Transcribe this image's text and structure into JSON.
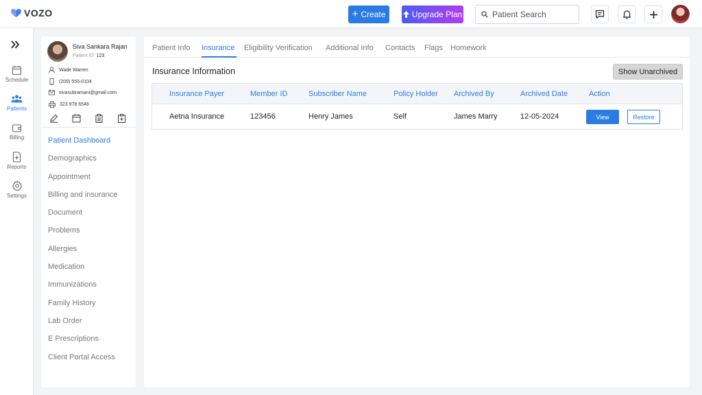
{
  "app": {
    "logo_text": "VOZO",
    "accent": "#2b7be4"
  },
  "header": {
    "create_label": "Create",
    "upgrade_label": "Upgrade Plan",
    "search": {
      "placeholder": "Patient Search",
      "value": ""
    },
    "icons": [
      "chat-icon",
      "bell-icon",
      "plus-icon"
    ]
  },
  "leftnav": {
    "items": [
      {
        "label": "Schedule",
        "icon": "calendar-icon",
        "active": false
      },
      {
        "label": "Patients",
        "icon": "users-icon",
        "active": true
      },
      {
        "label": "Billing",
        "icon": "wallet-icon",
        "active": false
      },
      {
        "label": "Reports",
        "icon": "report-icon",
        "active": false
      },
      {
        "label": "Settings",
        "icon": "gear-icon",
        "active": false
      }
    ]
  },
  "patient": {
    "name": "Siva Sankara Rajan",
    "id_label": "Patient ID:",
    "id_value": "123",
    "provider": "Wade Warren",
    "phone": "(209) 555-0104",
    "email": "sivasubramani@gmail.com",
    "fax": "323 978 6548"
  },
  "menu": {
    "items": [
      {
        "label": "Patient Dashboard",
        "active": true
      },
      {
        "label": "Demographics"
      },
      {
        "label": "Appointment"
      },
      {
        "label": "Billing and insurance"
      },
      {
        "label": "Document"
      },
      {
        "label": "Problems"
      },
      {
        "label": "Allergies"
      },
      {
        "label": "Medication"
      },
      {
        "label": "Immunizations"
      },
      {
        "label": "Family History"
      },
      {
        "label": "Lab Order"
      },
      {
        "label": "E Prescriptions"
      },
      {
        "label": "Client Portal Access"
      }
    ]
  },
  "tabs": {
    "items": [
      {
        "label": "Patient Info"
      },
      {
        "label": "Insurance",
        "active": true
      },
      {
        "label": "Eligibility Verification"
      },
      {
        "label": "Additional Info"
      },
      {
        "label": "Contacts"
      },
      {
        "label": "Flags"
      },
      {
        "label": "Homework"
      }
    ]
  },
  "main": {
    "title": "Insurance Information",
    "show_unarchived_label": "Show Unarchived",
    "table": {
      "headers": [
        "Insurance Payer",
        "Member ID",
        "Subscriber Name",
        "Policy Holder",
        "Archived By",
        "Archived Date",
        "Action"
      ],
      "rows": [
        {
          "payer": "Aetna Insurance",
          "member_id": "123456",
          "subscriber": "Henry James",
          "holder": "Self",
          "archived_by": "James Marry",
          "archived_date": "12-05-2024",
          "view_label": "View",
          "restore_label": "Restore"
        }
      ]
    }
  }
}
